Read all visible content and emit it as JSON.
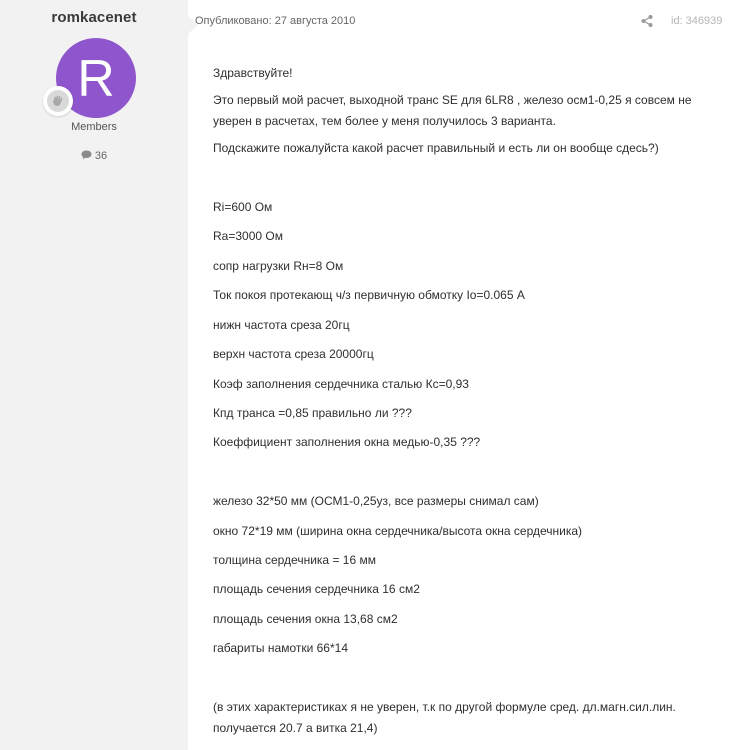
{
  "author": {
    "username": "romkacenet",
    "avatar_letter": "R",
    "avatar_color": "#8e55cc",
    "rank_icon": "hand-badge-icon",
    "group": "Members",
    "post_count": "36",
    "post_count_icon": "comment-icon"
  },
  "meta": {
    "published": "Опубликовано: 27 августа 2010",
    "share_icon": "share-icon",
    "post_id": "id: 346939"
  },
  "content": {
    "lines": [
      "Здравствуйте!",
      "Это первый мой расчет, выходной транс SE для 6LR8 , железо осм1-0,25 я совсем не уверен в расчетах, тем более у меня получилось 3 варианта.",
      "Подскажите пожалуйста какой расчет правильный и есть ли он вообще сдесь?)",
      "Ri=600 Ом",
      "Ra=3000 Ом",
      "сопр нагрузки Rн=8 Ом",
      "Ток покоя протекающ ч/з первичную обмотку Io=0.065 А",
      "нижн частота среза 20гц",
      "верхн частота среза 20000гц",
      "Коэф заполнения сердечника сталью Кс=0,93",
      "Кпд транса =0,85 правильно ли ???",
      "Коеффициент заполнения окна медью-0,35 ???",
      "железо 32*50 мм (ОСМ1-0,25уз, все размеры снимал сам)",
      "окно 72*19 мм (ширина окна сердечника/высота окна сердечника)",
      "толщина сердечника = 16 мм",
      "площадь сечения сердечника 16 см2",
      "площадь сечения окна 13,68 см2",
      "габариты намотки 66*14",
      "(в этих характеристиках я не уверен, т.к по другой формуле сред. дл.магн.сил.лин. получается 20.7 а витка 21,4)"
    ]
  }
}
